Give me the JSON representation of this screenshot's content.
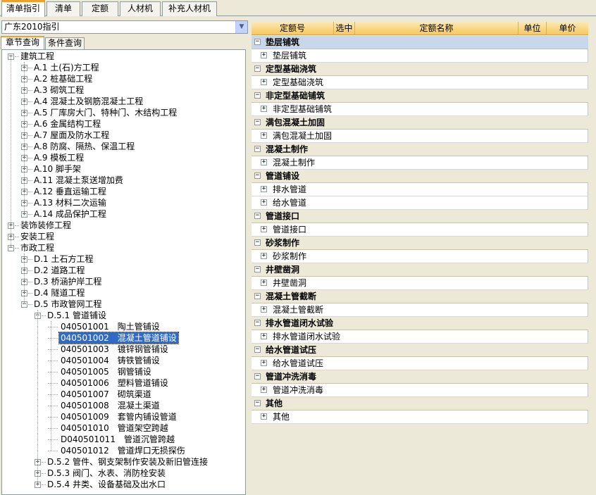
{
  "top_tabs": [
    "清单指引",
    "清单",
    "定额",
    "人材机",
    "补充人材机"
  ],
  "left": {
    "combo_value": "广东2010指引",
    "sub_tabs": [
      "章节查询",
      "条件查询"
    ],
    "tree": [
      {
        "label": "建筑工程",
        "level": 0,
        "expander": "-"
      },
      {
        "label": "A.1 土(石)方工程",
        "level": 1,
        "expander": "+"
      },
      {
        "label": "A.2 桩基础工程",
        "level": 1,
        "expander": "+"
      },
      {
        "label": "A.3 砌筑工程",
        "level": 1,
        "expander": "+"
      },
      {
        "label": "A.4 混凝土及钢筋混凝土工程",
        "level": 1,
        "expander": "+"
      },
      {
        "label": "A.5 厂库房大门、特种门、木结构工程",
        "level": 1,
        "expander": "+"
      },
      {
        "label": "A.6 金属结构工程",
        "level": 1,
        "expander": "+"
      },
      {
        "label": "A.7 屋面及防水工程",
        "level": 1,
        "expander": "+"
      },
      {
        "label": "A.8 防腐、隔热、保温工程",
        "level": 1,
        "expander": "+"
      },
      {
        "label": "A.9 模板工程",
        "level": 1,
        "expander": "+"
      },
      {
        "label": "A.10 脚手架",
        "level": 1,
        "expander": "+"
      },
      {
        "label": "A.11 混凝土泵送增加费",
        "level": 1,
        "expander": "+"
      },
      {
        "label": "A.12 垂直运输工程",
        "level": 1,
        "expander": "+"
      },
      {
        "label": "A.13 材料二次运输",
        "level": 1,
        "expander": "+"
      },
      {
        "label": "A.14 成品保护工程",
        "level": 1,
        "expander": "+"
      },
      {
        "label": "装饰装修工程",
        "level": 0,
        "expander": "+"
      },
      {
        "label": "安装工程",
        "level": 0,
        "expander": "+"
      },
      {
        "label": "市政工程",
        "level": 0,
        "expander": "-"
      },
      {
        "label": "D.1 土石方工程",
        "level": 1,
        "expander": "+"
      },
      {
        "label": "D.2 道路工程",
        "level": 1,
        "expander": "+"
      },
      {
        "label": "D.3 桥涵护岸工程",
        "level": 1,
        "expander": "+"
      },
      {
        "label": "D.4 隧道工程",
        "level": 1,
        "expander": "+"
      },
      {
        "label": "D.5 市政管网工程",
        "level": 1,
        "expander": "-"
      },
      {
        "label": "D.5.1 管道铺设",
        "level": 2,
        "expander": "-"
      },
      {
        "label": "040501001　陶土管铺设",
        "level": 3,
        "expander": ""
      },
      {
        "label": "040501002　混凝土管道铺设",
        "level": 3,
        "expander": "",
        "selected": true
      },
      {
        "label": "040501003　镀锌钢管铺设",
        "level": 3,
        "expander": ""
      },
      {
        "label": "040501004　铸铁管铺设",
        "level": 3,
        "expander": ""
      },
      {
        "label": "040501005　钢管铺设",
        "level": 3,
        "expander": ""
      },
      {
        "label": "040501006　塑料管道铺设",
        "level": 3,
        "expander": ""
      },
      {
        "label": "040501007　砌筑渠道",
        "level": 3,
        "expander": ""
      },
      {
        "label": "040501008　混凝土渠道",
        "level": 3,
        "expander": ""
      },
      {
        "label": "040501009　套管内铺设管道",
        "level": 3,
        "expander": ""
      },
      {
        "label": "040501010　管道架空跨越",
        "level": 3,
        "expander": ""
      },
      {
        "label": "D040501011　管道沉管跨越",
        "level": 3,
        "expander": ""
      },
      {
        "label": "040501012　管道焊口无损探伤",
        "level": 3,
        "expander": ""
      },
      {
        "label": "D.5.2 管件、钢支架制作安装及新旧管连接",
        "level": 2,
        "expander": "+"
      },
      {
        "label": "D.5.3 阀门、水表、消防栓安装",
        "level": 2,
        "expander": "+"
      },
      {
        "label": "D.5.4 井类、设备基础及出水口",
        "level": 2,
        "expander": "+"
      }
    ]
  },
  "grid": {
    "headers": [
      "定额号",
      "选中",
      "定额名称",
      "单位",
      "单价"
    ],
    "groups": [
      {
        "label": "垫层铺筑",
        "items": [
          "垫层铺筑"
        ]
      },
      {
        "label": "定型基础浇筑",
        "items": [
          "定型基础浇筑"
        ]
      },
      {
        "label": "非定型基础铺筑",
        "items": [
          "非定型基础铺筑"
        ]
      },
      {
        "label": "满包混凝土加固",
        "items": [
          "满包混凝土加固"
        ]
      },
      {
        "label": "混凝土制作",
        "items": [
          "混凝土制作"
        ]
      },
      {
        "label": "管道铺设",
        "items": [
          "排水管道",
          "给水管道"
        ]
      },
      {
        "label": "管道接口",
        "items": [
          "管道接口"
        ]
      },
      {
        "label": "砂浆制作",
        "items": [
          "砂浆制作"
        ]
      },
      {
        "label": "井壁凿洞",
        "items": [
          "井壁凿洞"
        ]
      },
      {
        "label": "混凝土管截断",
        "items": [
          "混凝土管截断"
        ]
      },
      {
        "label": "排水管道闭水试验",
        "items": [
          "排水管道闭水试验"
        ]
      },
      {
        "label": "给水管道试压",
        "items": [
          "给水管道试压"
        ]
      },
      {
        "label": "管道冲洗消毒",
        "items": [
          "管道冲洗消毒"
        ]
      },
      {
        "label": "其他",
        "items": [
          "其他"
        ]
      }
    ]
  }
}
